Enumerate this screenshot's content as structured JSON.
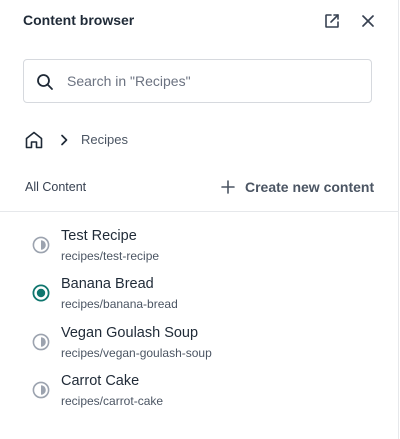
{
  "panel": {
    "title": "Content browser"
  },
  "header_icons": {
    "open_external": "open-external-icon",
    "close": "close-icon"
  },
  "search": {
    "placeholder": "Search in \"Recipes\"",
    "value": ""
  },
  "breadcrumb": {
    "home_icon": "home-icon",
    "separator_icon": "chevron-right-icon",
    "current": "Recipes"
  },
  "toolbar": {
    "all_content_label": "All Content",
    "create_label": "Create new content"
  },
  "items": [
    {
      "title": "Test Recipe",
      "path": "recipes/test-recipe",
      "status": "in-progress",
      "selected": false
    },
    {
      "title": "Banana Bread",
      "path": "recipes/banana-bread",
      "status": "selected",
      "selected": true
    },
    {
      "title": "Vegan Goulash Soup",
      "path": "recipes/vegan-goulash-soup",
      "status": "in-progress",
      "selected": false
    },
    {
      "title": "Carrot Cake",
      "path": "recipes/carrot-cake",
      "status": "in-progress",
      "selected": false
    }
  ],
  "colors": {
    "accent": "#0f766e",
    "status_gray": "#9ca3af",
    "text": "#1f2a37",
    "muted": "#4b5563",
    "border": "#d6d9de"
  }
}
